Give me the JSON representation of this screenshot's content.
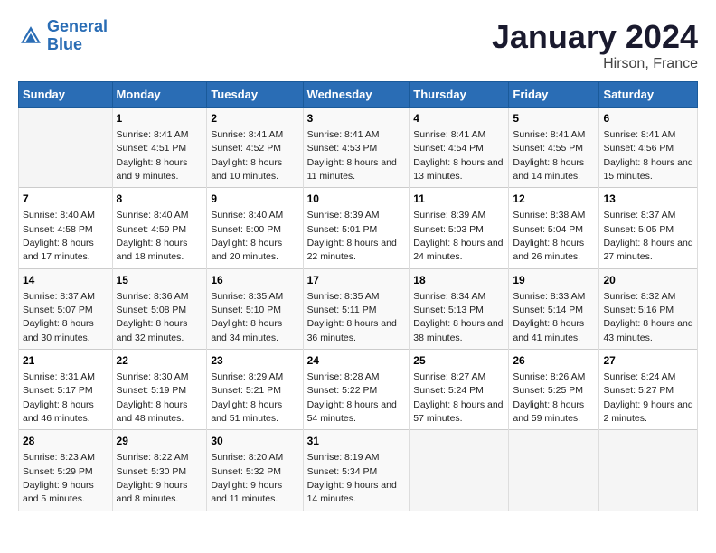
{
  "logo": {
    "line1": "General",
    "line2": "Blue"
  },
  "title": "January 2024",
  "subtitle": "Hirson, France",
  "days_of_week": [
    "Sunday",
    "Monday",
    "Tuesday",
    "Wednesday",
    "Thursday",
    "Friday",
    "Saturday"
  ],
  "weeks": [
    [
      {
        "day": "",
        "sunrise": "",
        "sunset": "",
        "daylight": ""
      },
      {
        "day": "1",
        "sunrise": "Sunrise: 8:41 AM",
        "sunset": "Sunset: 4:51 PM",
        "daylight": "Daylight: 8 hours and 9 minutes."
      },
      {
        "day": "2",
        "sunrise": "Sunrise: 8:41 AM",
        "sunset": "Sunset: 4:52 PM",
        "daylight": "Daylight: 8 hours and 10 minutes."
      },
      {
        "day": "3",
        "sunrise": "Sunrise: 8:41 AM",
        "sunset": "Sunset: 4:53 PM",
        "daylight": "Daylight: 8 hours and 11 minutes."
      },
      {
        "day": "4",
        "sunrise": "Sunrise: 8:41 AM",
        "sunset": "Sunset: 4:54 PM",
        "daylight": "Daylight: 8 hours and 13 minutes."
      },
      {
        "day": "5",
        "sunrise": "Sunrise: 8:41 AM",
        "sunset": "Sunset: 4:55 PM",
        "daylight": "Daylight: 8 hours and 14 minutes."
      },
      {
        "day": "6",
        "sunrise": "Sunrise: 8:41 AM",
        "sunset": "Sunset: 4:56 PM",
        "daylight": "Daylight: 8 hours and 15 minutes."
      }
    ],
    [
      {
        "day": "7",
        "sunrise": "Sunrise: 8:40 AM",
        "sunset": "Sunset: 4:58 PM",
        "daylight": "Daylight: 8 hours and 17 minutes."
      },
      {
        "day": "8",
        "sunrise": "Sunrise: 8:40 AM",
        "sunset": "Sunset: 4:59 PM",
        "daylight": "Daylight: 8 hours and 18 minutes."
      },
      {
        "day": "9",
        "sunrise": "Sunrise: 8:40 AM",
        "sunset": "Sunset: 5:00 PM",
        "daylight": "Daylight: 8 hours and 20 minutes."
      },
      {
        "day": "10",
        "sunrise": "Sunrise: 8:39 AM",
        "sunset": "Sunset: 5:01 PM",
        "daylight": "Daylight: 8 hours and 22 minutes."
      },
      {
        "day": "11",
        "sunrise": "Sunrise: 8:39 AM",
        "sunset": "Sunset: 5:03 PM",
        "daylight": "Daylight: 8 hours and 24 minutes."
      },
      {
        "day": "12",
        "sunrise": "Sunrise: 8:38 AM",
        "sunset": "Sunset: 5:04 PM",
        "daylight": "Daylight: 8 hours and 26 minutes."
      },
      {
        "day": "13",
        "sunrise": "Sunrise: 8:37 AM",
        "sunset": "Sunset: 5:05 PM",
        "daylight": "Daylight: 8 hours and 27 minutes."
      }
    ],
    [
      {
        "day": "14",
        "sunrise": "Sunrise: 8:37 AM",
        "sunset": "Sunset: 5:07 PM",
        "daylight": "Daylight: 8 hours and 30 minutes."
      },
      {
        "day": "15",
        "sunrise": "Sunrise: 8:36 AM",
        "sunset": "Sunset: 5:08 PM",
        "daylight": "Daylight: 8 hours and 32 minutes."
      },
      {
        "day": "16",
        "sunrise": "Sunrise: 8:35 AM",
        "sunset": "Sunset: 5:10 PM",
        "daylight": "Daylight: 8 hours and 34 minutes."
      },
      {
        "day": "17",
        "sunrise": "Sunrise: 8:35 AM",
        "sunset": "Sunset: 5:11 PM",
        "daylight": "Daylight: 8 hours and 36 minutes."
      },
      {
        "day": "18",
        "sunrise": "Sunrise: 8:34 AM",
        "sunset": "Sunset: 5:13 PM",
        "daylight": "Daylight: 8 hours and 38 minutes."
      },
      {
        "day": "19",
        "sunrise": "Sunrise: 8:33 AM",
        "sunset": "Sunset: 5:14 PM",
        "daylight": "Daylight: 8 hours and 41 minutes."
      },
      {
        "day": "20",
        "sunrise": "Sunrise: 8:32 AM",
        "sunset": "Sunset: 5:16 PM",
        "daylight": "Daylight: 8 hours and 43 minutes."
      }
    ],
    [
      {
        "day": "21",
        "sunrise": "Sunrise: 8:31 AM",
        "sunset": "Sunset: 5:17 PM",
        "daylight": "Daylight: 8 hours and 46 minutes."
      },
      {
        "day": "22",
        "sunrise": "Sunrise: 8:30 AM",
        "sunset": "Sunset: 5:19 PM",
        "daylight": "Daylight: 8 hours and 48 minutes."
      },
      {
        "day": "23",
        "sunrise": "Sunrise: 8:29 AM",
        "sunset": "Sunset: 5:21 PM",
        "daylight": "Daylight: 8 hours and 51 minutes."
      },
      {
        "day": "24",
        "sunrise": "Sunrise: 8:28 AM",
        "sunset": "Sunset: 5:22 PM",
        "daylight": "Daylight: 8 hours and 54 minutes."
      },
      {
        "day": "25",
        "sunrise": "Sunrise: 8:27 AM",
        "sunset": "Sunset: 5:24 PM",
        "daylight": "Daylight: 8 hours and 57 minutes."
      },
      {
        "day": "26",
        "sunrise": "Sunrise: 8:26 AM",
        "sunset": "Sunset: 5:25 PM",
        "daylight": "Daylight: 8 hours and 59 minutes."
      },
      {
        "day": "27",
        "sunrise": "Sunrise: 8:24 AM",
        "sunset": "Sunset: 5:27 PM",
        "daylight": "Daylight: 9 hours and 2 minutes."
      }
    ],
    [
      {
        "day": "28",
        "sunrise": "Sunrise: 8:23 AM",
        "sunset": "Sunset: 5:29 PM",
        "daylight": "Daylight: 9 hours and 5 minutes."
      },
      {
        "day": "29",
        "sunrise": "Sunrise: 8:22 AM",
        "sunset": "Sunset: 5:30 PM",
        "daylight": "Daylight: 9 hours and 8 minutes."
      },
      {
        "day": "30",
        "sunrise": "Sunrise: 8:20 AM",
        "sunset": "Sunset: 5:32 PM",
        "daylight": "Daylight: 9 hours and 11 minutes."
      },
      {
        "day": "31",
        "sunrise": "Sunrise: 8:19 AM",
        "sunset": "Sunset: 5:34 PM",
        "daylight": "Daylight: 9 hours and 14 minutes."
      },
      {
        "day": "",
        "sunrise": "",
        "sunset": "",
        "daylight": ""
      },
      {
        "day": "",
        "sunrise": "",
        "sunset": "",
        "daylight": ""
      },
      {
        "day": "",
        "sunrise": "",
        "sunset": "",
        "daylight": ""
      }
    ]
  ]
}
